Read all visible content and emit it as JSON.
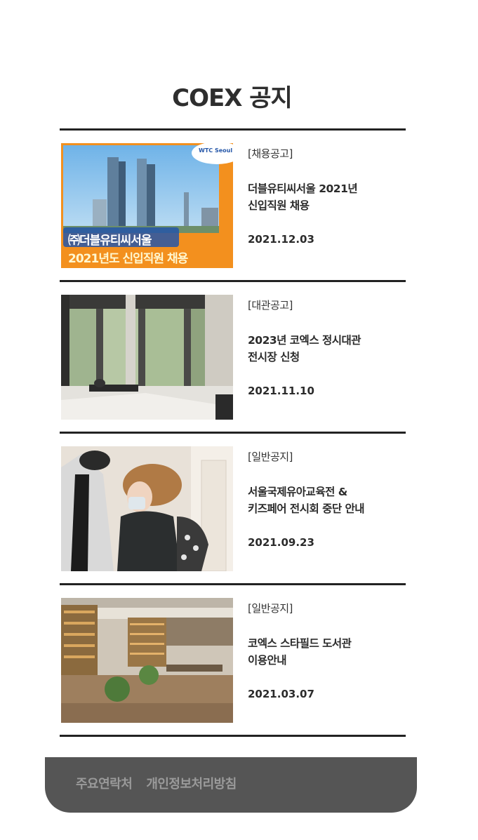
{
  "page": {
    "title": "COEX 공지"
  },
  "notices": [
    {
      "category": "[채용공고]",
      "title": "더블유티씨서울 2021년\n신입직원 채용",
      "date": "2021.12.03",
      "thumbnail": {
        "badge": "WTC Seoul",
        "line1": "㈜더블유티씨서울",
        "line2": "2021년도 신입직원 채용"
      }
    },
    {
      "category": "[대관공고]",
      "title": "2023년 코엑스 정시대관\n전시장 신청",
      "date": "2021.11.10"
    },
    {
      "category": "[일반공지]",
      "title": "서울국제유아교육전 &\n키즈페어 전시회 중단 안내",
      "date": "2021.09.23"
    },
    {
      "category": "[일반공지]",
      "title": "코엑스 스타필드 도서관\n이용안내",
      "date": "2021.03.07"
    }
  ],
  "footer": {
    "links": [
      "주요연락처",
      "개인정보처리방침"
    ]
  },
  "colors": {
    "divider": "#222222",
    "footer_bg": "#555555",
    "footer_text": "#9a9a9a",
    "accent_orange": "#f3901e"
  }
}
